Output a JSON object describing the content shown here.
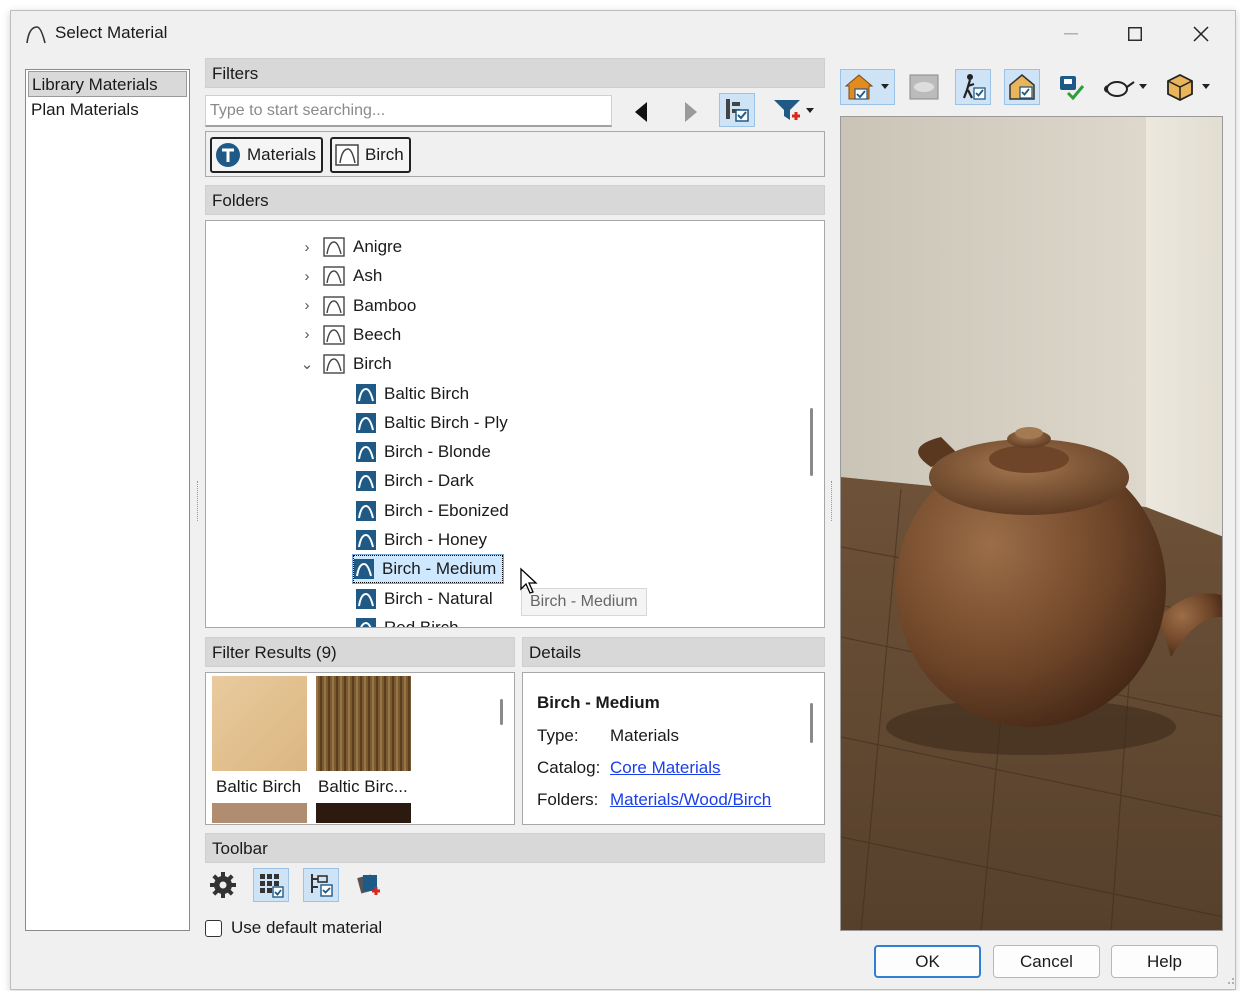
{
  "window": {
    "title": "Select Material"
  },
  "left_list": {
    "items": [
      "Library Materials",
      "Plan Materials"
    ],
    "selected": "Library Materials"
  },
  "filters": {
    "header": "Filters",
    "search_placeholder": "Type to start searching...",
    "chips": [
      "Materials",
      "Birch"
    ]
  },
  "folders": {
    "header": "Folders",
    "items": [
      {
        "label": "Anigre",
        "kind": "folder",
        "expanded": false
      },
      {
        "label": "Ash",
        "kind": "folder",
        "expanded": false
      },
      {
        "label": "Bamboo",
        "kind": "folder",
        "expanded": false
      },
      {
        "label": "Beech",
        "kind": "folder",
        "expanded": false
      },
      {
        "label": "Birch",
        "kind": "folder",
        "expanded": true
      },
      {
        "label": "Baltic Birch",
        "kind": "material"
      },
      {
        "label": "Baltic Birch - Ply",
        "kind": "material"
      },
      {
        "label": "Birch - Blonde",
        "kind": "material"
      },
      {
        "label": "Birch - Dark",
        "kind": "material"
      },
      {
        "label": "Birch - Ebonized",
        "kind": "material"
      },
      {
        "label": "Birch - Honey",
        "kind": "material"
      },
      {
        "label": "Birch - Medium",
        "kind": "material",
        "selected": true
      },
      {
        "label": "Birch - Natural",
        "kind": "material"
      },
      {
        "label": "Red Birch",
        "kind": "material"
      }
    ],
    "tooltip": "Birch - Medium"
  },
  "filter_results": {
    "header": "Filter Results (9)",
    "items": [
      {
        "label": "Baltic Birch"
      },
      {
        "label": "Baltic Birc..."
      }
    ]
  },
  "details": {
    "header": "Details",
    "name": "Birch - Medium",
    "type_label": "Type:",
    "type_value": "Materials",
    "catalog_label": "Catalog:",
    "catalog_value": "Core Materials",
    "folders_label": "Folders:",
    "folders_value": "Materials/Wood/Birch"
  },
  "toolbar": {
    "header": "Toolbar"
  },
  "use_default": {
    "label": "Use default material",
    "checked": false
  },
  "buttons": {
    "ok": "OK",
    "cancel": "Cancel",
    "help": "Help"
  },
  "colors": {
    "accent": "#2f7fd2",
    "selection": "#cde8ff",
    "link": "#1a3ee8",
    "material_icon": "#1f5a86"
  }
}
